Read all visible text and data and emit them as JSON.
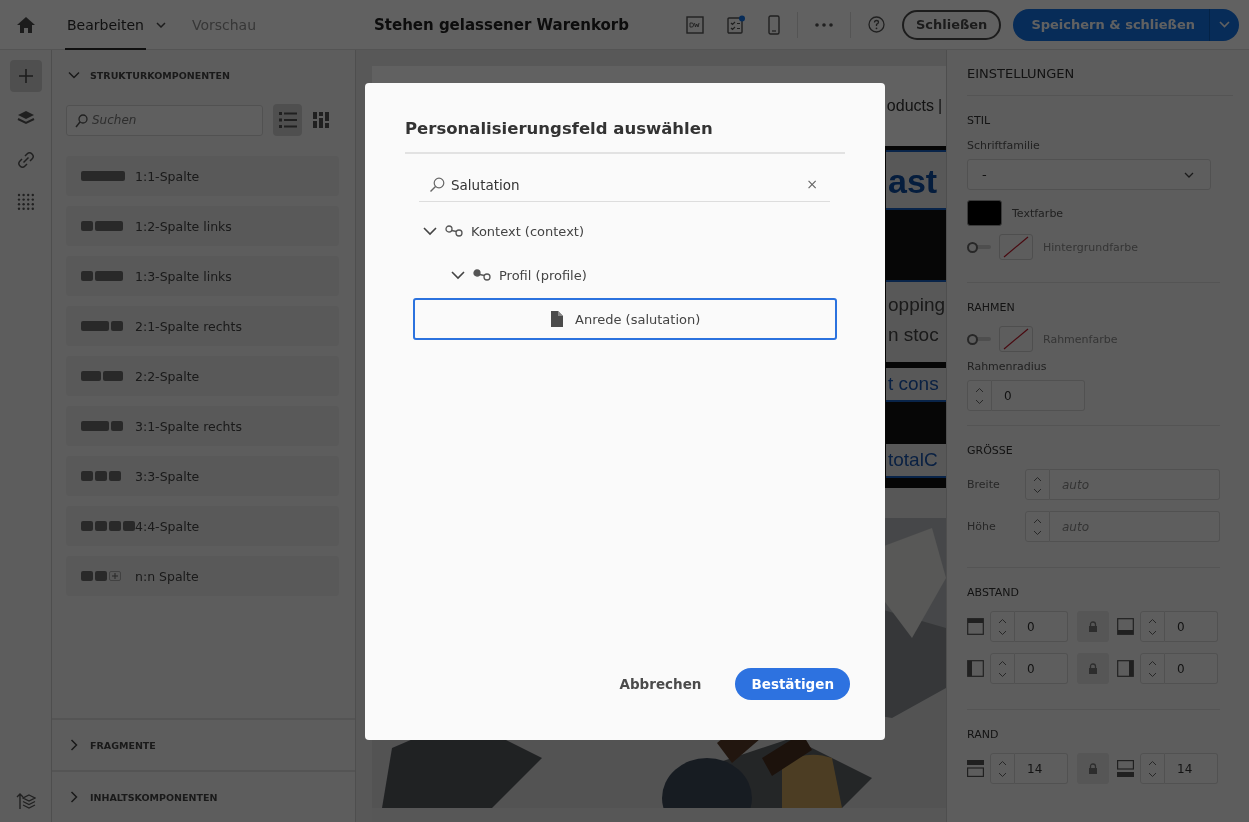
{
  "topbar": {
    "tabs": [
      {
        "label": "Bearbeiten",
        "selected": true,
        "menu": true
      },
      {
        "label": "Vorschau",
        "selected": false,
        "menu": false
      }
    ],
    "title": "Stehen gelassener Warenkorb",
    "close_button": "Schließen",
    "save_button": "Speichern & schließen"
  },
  "rail": [
    {
      "kind": "add",
      "selected": true
    },
    {
      "kind": "layers",
      "selected": false
    },
    {
      "kind": "link",
      "selected": false
    },
    {
      "kind": "components",
      "selected": false
    }
  ],
  "left_panel": {
    "sections": [
      {
        "title": "STRUKTURKOMPONENTEN",
        "expanded": true
      },
      {
        "title": "FRAGMENTE",
        "expanded": false
      },
      {
        "title": "INHALTSKOMPONENTEN",
        "expanded": false
      }
    ],
    "search": {
      "placeholder": "Suchen"
    },
    "views": [
      {
        "kind": "list",
        "selected": true
      },
      {
        "kind": "grid",
        "selected": false
      }
    ],
    "components": [
      {
        "label": "1:1-Spalte",
        "kind": "full"
      },
      {
        "label": "1:2-Spalte links",
        "kind": "small_large"
      },
      {
        "label": "1:3-Spalte links",
        "kind": "small_large"
      },
      {
        "label": "2:1-Spalte rechts",
        "kind": "large_small"
      },
      {
        "label": "2:2-Spalte",
        "kind": "halves"
      },
      {
        "label": "3:1-Spalte rechts",
        "kind": "large_small"
      },
      {
        "label": "3:3-Spalte",
        "kind": "thirds"
      },
      {
        "label": "4:4-Spalte",
        "kind": "quarters"
      },
      {
        "label": "n:n Spalte",
        "kind": "custom"
      }
    ]
  },
  "email_preview": {
    "nav_text": "oducts",
    "separator": "|",
    "blocks": [
      {
        "kind": "headline",
        "text": "ast"
      },
      {
        "kind": "body",
        "text": "opping"
      },
      {
        "kind": "body",
        "text": "n stoc"
      },
      {
        "kind": "link",
        "text": "t cons"
      },
      {
        "kind": "link",
        "text": "totalC"
      }
    ]
  },
  "settings": {
    "title": "EINSTELLUNGEN",
    "stil": {
      "heading": "STIL",
      "font_label": "Schriftfamilie",
      "font_value": "-",
      "text_color_label": "Textfarbe",
      "bg_toggle_on": false,
      "bg_label": "Hintergrundfarbe"
    },
    "rahmen": {
      "heading": "RAHMEN",
      "toggle_on": false,
      "color_label": "Rahmenfarbe",
      "radius_label": "Rahmenradius",
      "radius_value": "0"
    },
    "groesse": {
      "heading": "GRÖSSE",
      "fields": [
        {
          "label": "Breite",
          "placeholder": "auto"
        },
        {
          "label": "Höhe",
          "placeholder": "auto"
        }
      ]
    },
    "abstand": {
      "heading": "ABSTAND",
      "fields": [
        {
          "kind": "top",
          "value": "0"
        },
        {
          "kind": "bottom",
          "value": "0"
        },
        {
          "kind": "left",
          "value": "0"
        },
        {
          "kind": "right",
          "value": "0"
        }
      ]
    },
    "rand": {
      "heading": "RAND",
      "fields": [
        {
          "kind": "top",
          "value": "14"
        },
        {
          "kind": "bottom",
          "value": "14"
        }
      ]
    }
  },
  "dialog": {
    "title": "Personalisierungsfeld auswählen",
    "search_value": "Salutation",
    "clear": "×",
    "tree": [
      {
        "label": "Kontext (context)",
        "kind": "node",
        "expanded": true,
        "selected": false,
        "children": [
          {
            "label": "Profil (profile)",
            "kind": "node",
            "expanded": true,
            "selected": false,
            "children": [
              {
                "label": "Anrede (salutation)",
                "kind": "field",
                "selected": true
              }
            ]
          }
        ]
      }
    ],
    "cancel": "Abbrechen",
    "confirm": "Bestätigen"
  }
}
